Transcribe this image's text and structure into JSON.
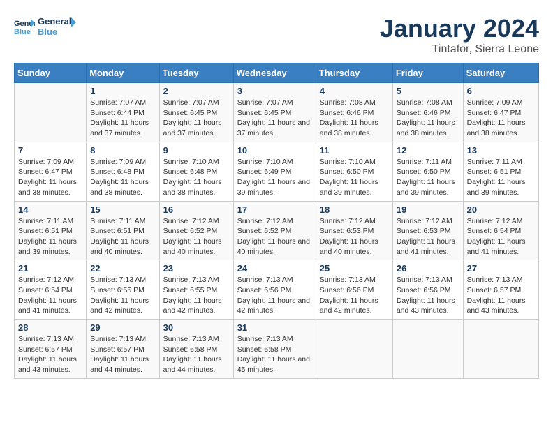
{
  "logo": {
    "text_general": "General",
    "text_blue": "Blue"
  },
  "title": "January 2024",
  "subtitle": "Tintafor, Sierra Leone",
  "weekdays": [
    "Sunday",
    "Monday",
    "Tuesday",
    "Wednesday",
    "Thursday",
    "Friday",
    "Saturday"
  ],
  "weeks": [
    [
      {
        "day": "",
        "sunrise": "",
        "sunset": "",
        "daylight": ""
      },
      {
        "day": "1",
        "sunrise": "Sunrise: 7:07 AM",
        "sunset": "Sunset: 6:44 PM",
        "daylight": "Daylight: 11 hours and 37 minutes."
      },
      {
        "day": "2",
        "sunrise": "Sunrise: 7:07 AM",
        "sunset": "Sunset: 6:45 PM",
        "daylight": "Daylight: 11 hours and 37 minutes."
      },
      {
        "day": "3",
        "sunrise": "Sunrise: 7:07 AM",
        "sunset": "Sunset: 6:45 PM",
        "daylight": "Daylight: 11 hours and 37 minutes."
      },
      {
        "day": "4",
        "sunrise": "Sunrise: 7:08 AM",
        "sunset": "Sunset: 6:46 PM",
        "daylight": "Daylight: 11 hours and 38 minutes."
      },
      {
        "day": "5",
        "sunrise": "Sunrise: 7:08 AM",
        "sunset": "Sunset: 6:46 PM",
        "daylight": "Daylight: 11 hours and 38 minutes."
      },
      {
        "day": "6",
        "sunrise": "Sunrise: 7:09 AM",
        "sunset": "Sunset: 6:47 PM",
        "daylight": "Daylight: 11 hours and 38 minutes."
      }
    ],
    [
      {
        "day": "7",
        "sunrise": "Sunrise: 7:09 AM",
        "sunset": "Sunset: 6:47 PM",
        "daylight": "Daylight: 11 hours and 38 minutes."
      },
      {
        "day": "8",
        "sunrise": "Sunrise: 7:09 AM",
        "sunset": "Sunset: 6:48 PM",
        "daylight": "Daylight: 11 hours and 38 minutes."
      },
      {
        "day": "9",
        "sunrise": "Sunrise: 7:10 AM",
        "sunset": "Sunset: 6:48 PM",
        "daylight": "Daylight: 11 hours and 38 minutes."
      },
      {
        "day": "10",
        "sunrise": "Sunrise: 7:10 AM",
        "sunset": "Sunset: 6:49 PM",
        "daylight": "Daylight: 11 hours and 39 minutes."
      },
      {
        "day": "11",
        "sunrise": "Sunrise: 7:10 AM",
        "sunset": "Sunset: 6:50 PM",
        "daylight": "Daylight: 11 hours and 39 minutes."
      },
      {
        "day": "12",
        "sunrise": "Sunrise: 7:11 AM",
        "sunset": "Sunset: 6:50 PM",
        "daylight": "Daylight: 11 hours and 39 minutes."
      },
      {
        "day": "13",
        "sunrise": "Sunrise: 7:11 AM",
        "sunset": "Sunset: 6:51 PM",
        "daylight": "Daylight: 11 hours and 39 minutes."
      }
    ],
    [
      {
        "day": "14",
        "sunrise": "Sunrise: 7:11 AM",
        "sunset": "Sunset: 6:51 PM",
        "daylight": "Daylight: 11 hours and 39 minutes."
      },
      {
        "day": "15",
        "sunrise": "Sunrise: 7:11 AM",
        "sunset": "Sunset: 6:51 PM",
        "daylight": "Daylight: 11 hours and 40 minutes."
      },
      {
        "day": "16",
        "sunrise": "Sunrise: 7:12 AM",
        "sunset": "Sunset: 6:52 PM",
        "daylight": "Daylight: 11 hours and 40 minutes."
      },
      {
        "day": "17",
        "sunrise": "Sunrise: 7:12 AM",
        "sunset": "Sunset: 6:52 PM",
        "daylight": "Daylight: 11 hours and 40 minutes."
      },
      {
        "day": "18",
        "sunrise": "Sunrise: 7:12 AM",
        "sunset": "Sunset: 6:53 PM",
        "daylight": "Daylight: 11 hours and 40 minutes."
      },
      {
        "day": "19",
        "sunrise": "Sunrise: 7:12 AM",
        "sunset": "Sunset: 6:53 PM",
        "daylight": "Daylight: 11 hours and 41 minutes."
      },
      {
        "day": "20",
        "sunrise": "Sunrise: 7:12 AM",
        "sunset": "Sunset: 6:54 PM",
        "daylight": "Daylight: 11 hours and 41 minutes."
      }
    ],
    [
      {
        "day": "21",
        "sunrise": "Sunrise: 7:12 AM",
        "sunset": "Sunset: 6:54 PM",
        "daylight": "Daylight: 11 hours and 41 minutes."
      },
      {
        "day": "22",
        "sunrise": "Sunrise: 7:13 AM",
        "sunset": "Sunset: 6:55 PM",
        "daylight": "Daylight: 11 hours and 42 minutes."
      },
      {
        "day": "23",
        "sunrise": "Sunrise: 7:13 AM",
        "sunset": "Sunset: 6:55 PM",
        "daylight": "Daylight: 11 hours and 42 minutes."
      },
      {
        "day": "24",
        "sunrise": "Sunrise: 7:13 AM",
        "sunset": "Sunset: 6:56 PM",
        "daylight": "Daylight: 11 hours and 42 minutes."
      },
      {
        "day": "25",
        "sunrise": "Sunrise: 7:13 AM",
        "sunset": "Sunset: 6:56 PM",
        "daylight": "Daylight: 11 hours and 42 minutes."
      },
      {
        "day": "26",
        "sunrise": "Sunrise: 7:13 AM",
        "sunset": "Sunset: 6:56 PM",
        "daylight": "Daylight: 11 hours and 43 minutes."
      },
      {
        "day": "27",
        "sunrise": "Sunrise: 7:13 AM",
        "sunset": "Sunset: 6:57 PM",
        "daylight": "Daylight: 11 hours and 43 minutes."
      }
    ],
    [
      {
        "day": "28",
        "sunrise": "Sunrise: 7:13 AM",
        "sunset": "Sunset: 6:57 PM",
        "daylight": "Daylight: 11 hours and 43 minutes."
      },
      {
        "day": "29",
        "sunrise": "Sunrise: 7:13 AM",
        "sunset": "Sunset: 6:57 PM",
        "daylight": "Daylight: 11 hours and 44 minutes."
      },
      {
        "day": "30",
        "sunrise": "Sunrise: 7:13 AM",
        "sunset": "Sunset: 6:58 PM",
        "daylight": "Daylight: 11 hours and 44 minutes."
      },
      {
        "day": "31",
        "sunrise": "Sunrise: 7:13 AM",
        "sunset": "Sunset: 6:58 PM",
        "daylight": "Daylight: 11 hours and 45 minutes."
      },
      {
        "day": "",
        "sunrise": "",
        "sunset": "",
        "daylight": ""
      },
      {
        "day": "",
        "sunrise": "",
        "sunset": "",
        "daylight": ""
      },
      {
        "day": "",
        "sunrise": "",
        "sunset": "",
        "daylight": ""
      }
    ]
  ]
}
